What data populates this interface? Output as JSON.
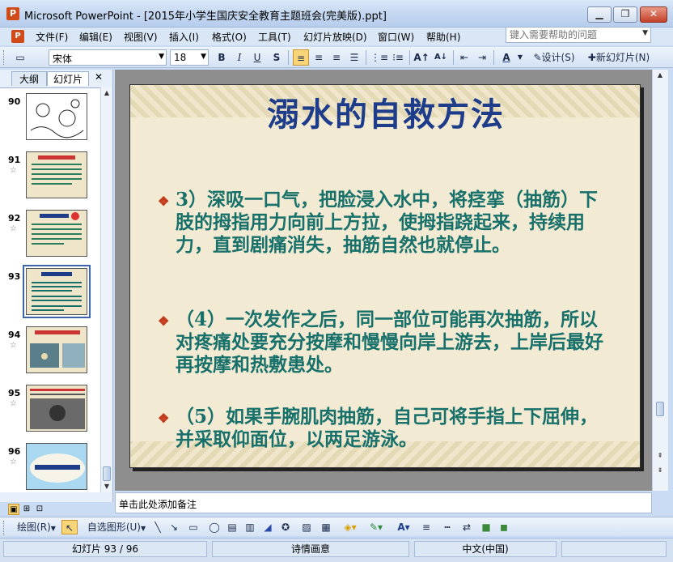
{
  "window": {
    "app_icon": "P",
    "title": "Microsoft PowerPoint - [2015年小学生国庆安全教育主题班会(完美版).ppt]",
    "minimize": "▁",
    "restore": "❐",
    "close": "✕"
  },
  "menu": {
    "items": [
      "文件(F)",
      "编辑(E)",
      "视图(V)",
      "插入(I)",
      "格式(O)",
      "工具(T)",
      "幻灯片放映(D)",
      "窗口(W)",
      "帮助(H)"
    ],
    "help_placeholder": "键入需要帮助的问题"
  },
  "format_toolbar": {
    "font_name": "宋体",
    "font_size": "18",
    "bold": "B",
    "italic": "I",
    "underline": "U",
    "shadow": "S",
    "grow": "A↑",
    "shrink": "A↓",
    "design": "设计(S)",
    "new_slide": "新幻灯片(N)"
  },
  "left_panel": {
    "tab_outline": "大纲",
    "tab_slides": "幻灯片",
    "close": "✕",
    "thumbnails": [
      {
        "num": "90",
        "star": ""
      },
      {
        "num": "91",
        "star": "☆"
      },
      {
        "num": "92",
        "star": "☆"
      },
      {
        "num": "93",
        "star": ""
      },
      {
        "num": "94",
        "star": "☆"
      },
      {
        "num": "95",
        "star": "☆"
      },
      {
        "num": "96",
        "star": "☆"
      }
    ]
  },
  "slide": {
    "title": "溺水的自救方法",
    "bullet_symbol": "❖",
    "bullets": [
      "3）深吸一口气，把脸浸入水中，将痉挛（抽筋）下肢的拇指用力向前上方拉，使拇指跷起来，持续用力，直到剧痛消失，抽筋自然也就停止。",
      "（4）一次发作之后，同一部位可能再次抽筋，所以对疼痛处要充分按摩和慢慢向岸上游去，上岸后最好再按摩和热敷患处。",
      "（5）如果手腕肌肉抽筋，自己可将手指上下屈伸，并采取仰面位，以两足游泳。"
    ]
  },
  "notes": {
    "placeholder": "单击此处添加备注"
  },
  "draw_toolbar": {
    "draw": "绘图(R)",
    "autoshapes": "自选图形(U)"
  },
  "status": {
    "slide_counter": "幻灯片 93 / 96",
    "theme": "诗情画意",
    "language": "中文(中国)"
  }
}
